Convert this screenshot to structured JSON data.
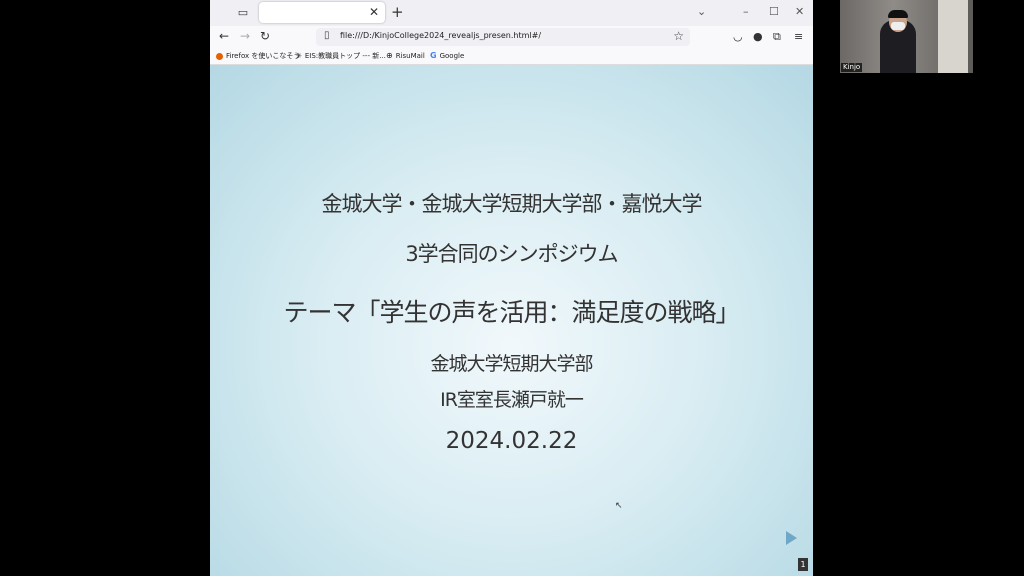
{
  "browser": {
    "url": "file:///D:/KinjoCollege2024_revealjs_presen.html#/",
    "tab_list_icon": "tab-list-icon",
    "new_tab_label": "+",
    "bookmarks": [
      {
        "label": "Firefox を使いこなそう",
        "icon": "firefox-icon"
      },
      {
        "label": "EIS:教職員トップ --- 新...",
        "icon": "bookmark-icon"
      },
      {
        "label": "RisuMail",
        "icon": "globe-icon"
      },
      {
        "label": "Google",
        "icon": "google-icon"
      }
    ]
  },
  "slide": {
    "line1": "金城大学・金城大学短期大学部・嘉悦大学",
    "line2": "3学合同のシンポジウム",
    "line3": "テーマ「学生の声を活用：満足度の戦略」",
    "line4": "金城大学短期大学部",
    "line5": "IR室室長瀬戸就一",
    "line6": "2024.02.22",
    "slide_number": "1"
  },
  "webcam": {
    "participant_name": "Kinjo"
  },
  "colors": {
    "slide_bg_center": "#f1f8fb",
    "slide_bg_edge": "#b4d8e4",
    "nav_arrow": "#6fa7c6"
  }
}
